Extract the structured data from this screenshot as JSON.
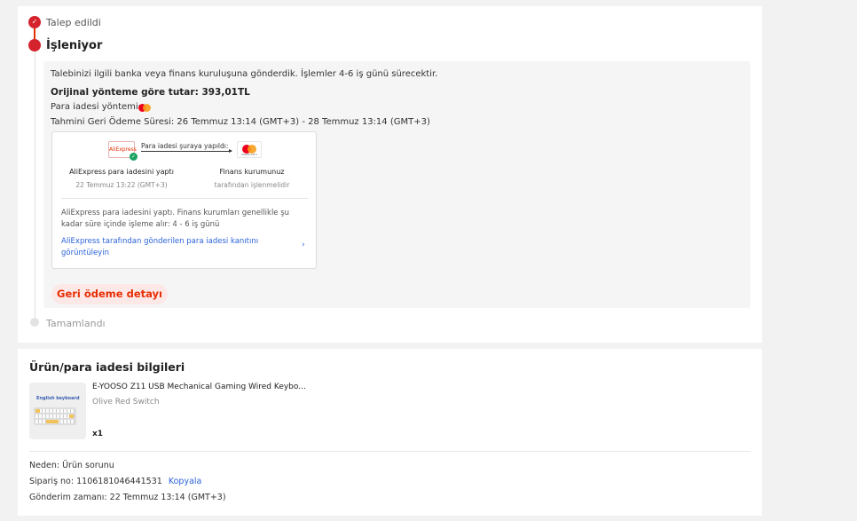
{
  "timeline": {
    "steps": [
      {
        "label": "Talep edildi",
        "state": "done"
      },
      {
        "label": "İşleniyor",
        "state": "active"
      },
      {
        "label": "Tamamlandı",
        "state": "pending"
      }
    ],
    "accent_color": "#d4232c"
  },
  "refund_info": {
    "intro": "Talebinizi ilgili banka veya finans kuruluşuna gönderdik. İşlemler 4-6 iş günü sürecektir.",
    "amount_label": "Orijinal yönteme göre tutar:",
    "amount_value": "393,01TL",
    "method_label": "Para iadesi yöntemi:",
    "method_icon": "mastercard-icon",
    "eta_label": "Tahmini Geri Ödeme Süresi:",
    "eta_value": "26 Temmuz 13:14 (GMT+3) - 28 Temmuz 13:14 (GMT+3)"
  },
  "flow": {
    "source_logo": "AliExpress",
    "arrow_label": "Para iadesi şuraya yapıldı:",
    "dest_caption": "MasterCard",
    "source_title": "AliExpress para iadesini yaptı",
    "source_time": "22 Temmuz 13:22 (GMT+3)",
    "dest_title": "Finans kurumunuz",
    "dest_status": "tarafından işlenmelidir",
    "note": "AliExpress para iadesini yaptı. Finans kurumları genellikle şu kadar süre içinde işleme alır: 4 - 6 iş günü",
    "proof_link": "AliExpress tarafından gönderilen para iadesi kanıtını görüntüleyin",
    "chevron": "›"
  },
  "detail_button": "Geri ödeme detayı",
  "product_section": {
    "title": "Ürün/para iadesi bilgileri",
    "product": {
      "image_label": "English keyboard",
      "name": "E-YOOSO Z11 USB Mechanical Gaming Wired Keybo...",
      "variant": "Olive Red Switch",
      "quantity": "x1"
    },
    "reason_label": "Neden:",
    "reason_value": "Ürün sorunu",
    "order_label": "Sipariş no:",
    "order_value": "1106181046441531",
    "copy_label": "Kopyala",
    "sent_label": "Gönderim zamanı:",
    "sent_value": "22 Temmuz 13:14 (GMT+3)"
  }
}
